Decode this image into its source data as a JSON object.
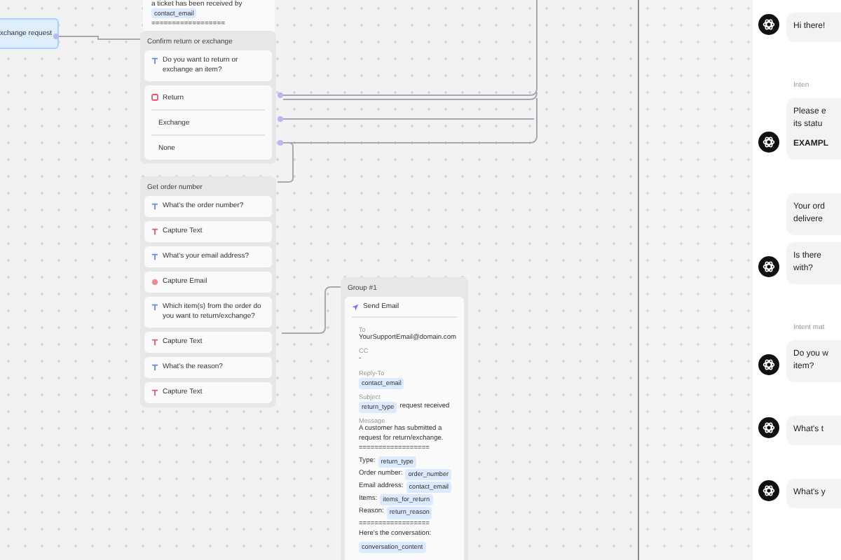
{
  "canvas": {
    "start_node": {
      "label": "xchange request"
    },
    "ticket_node": {
      "text": "a ticket has been received by",
      "variable": "contact_email",
      "rule": "=================="
    },
    "confirm_group": {
      "title": "Confirm return or exchange",
      "message": {
        "kind": "message",
        "text": "Do you want to return or exchange an item?"
      },
      "buttons": [
        {
          "label": "Return",
          "has_icon": true
        },
        {
          "label": "Exchange",
          "has_icon": false
        },
        {
          "label": "None",
          "has_icon": false
        }
      ]
    },
    "order_group": {
      "title": "Get order number",
      "steps": [
        {
          "kind": "message",
          "text": "What's the order number?"
        },
        {
          "kind": "capture_text",
          "text": "Capture Text"
        },
        {
          "kind": "message",
          "text": "What's your email address?"
        },
        {
          "kind": "capture_email",
          "text": "Capture Email"
        },
        {
          "kind": "message",
          "text": "Which item(s) from the order do you want to return/exchange?"
        },
        {
          "kind": "capture_text",
          "text": "Capture Text"
        },
        {
          "kind": "message",
          "text": "What's the reason?"
        },
        {
          "kind": "capture_text",
          "text": "Capture Text"
        }
      ]
    },
    "email_group": {
      "title": "Group #1",
      "action": "Send Email",
      "fields": [
        {
          "label": "To",
          "lines": [
            [
              {
                "kind": "text",
                "text": "YourSupportEmail@domain.com"
              }
            ]
          ]
        },
        {
          "label": "CC",
          "lines": [
            [
              {
                "kind": "text",
                "text": "-"
              }
            ]
          ]
        },
        {
          "label": "Reply-To",
          "lines": [
            [
              {
                "kind": "var",
                "text": "contact_email"
              }
            ]
          ]
        },
        {
          "label": "Subject",
          "lines": [
            [
              {
                "kind": "var",
                "text": "return_type"
              },
              {
                "kind": "text",
                "text": "request received"
              }
            ]
          ]
        },
        {
          "label": "Message",
          "lines": [
            [
              {
                "kind": "text",
                "text": "A customer has submitted a request for return/exchange."
              }
            ],
            [
              {
                "kind": "text",
                "text": "=================="
              }
            ],
            [
              {
                "kind": "text",
                "text": "Type:"
              },
              {
                "kind": "var",
                "text": "return_type"
              }
            ],
            [
              {
                "kind": "text",
                "text": "Order number:"
              },
              {
                "kind": "var",
                "text": "order_number"
              }
            ],
            [
              {
                "kind": "text",
                "text": "Email address:"
              },
              {
                "kind": "var",
                "text": "contact_email"
              }
            ],
            [
              {
                "kind": "text",
                "text": "Items:"
              },
              {
                "kind": "var",
                "text": "items_for_return"
              }
            ],
            [
              {
                "kind": "text",
                "text": "Reason:"
              },
              {
                "kind": "var",
                "text": "return_reason"
              }
            ],
            [
              {
                "kind": "text",
                "text": "=================="
              }
            ],
            [
              {
                "kind": "text",
                "text": "Here's the conversation:"
              }
            ],
            [
              {
                "kind": "var",
                "text": "conversation_content"
              }
            ]
          ]
        }
      ]
    }
  },
  "chat": {
    "messages": [
      {
        "kind": "bot",
        "avatar": true,
        "lines": [
          {
            "text": "Hi there!",
            "bold": false
          }
        ]
      },
      {
        "kind": "intent",
        "text": "Inten"
      },
      {
        "kind": "bot",
        "avatar": true,
        "lines": [
          {
            "text": "Please e",
            "bold": false
          },
          {
            "text": "its statu",
            "bold": false
          },
          {
            "text": "EXAMPL",
            "bold": true
          }
        ]
      },
      {
        "kind": "bot",
        "avatar": false,
        "lines": [
          {
            "text": "Your ord",
            "bold": false
          },
          {
            "text": "delivere",
            "bold": false
          }
        ]
      },
      {
        "kind": "bot",
        "avatar": true,
        "lines": [
          {
            "text": "Is there",
            "bold": false
          },
          {
            "text": "with?",
            "bold": false
          }
        ]
      },
      {
        "kind": "intent",
        "text": "Intent mat"
      },
      {
        "kind": "bot",
        "avatar": true,
        "lines": [
          {
            "text": "Do you w",
            "bold": false
          },
          {
            "text": "item?",
            "bold": false
          }
        ]
      },
      {
        "kind": "bot",
        "avatar": true,
        "lines": [
          {
            "text": "What's t",
            "bold": false
          }
        ]
      },
      {
        "kind": "bot",
        "avatar": true,
        "lines": [
          {
            "text": "What's y",
            "bold": false
          }
        ]
      }
    ]
  }
}
